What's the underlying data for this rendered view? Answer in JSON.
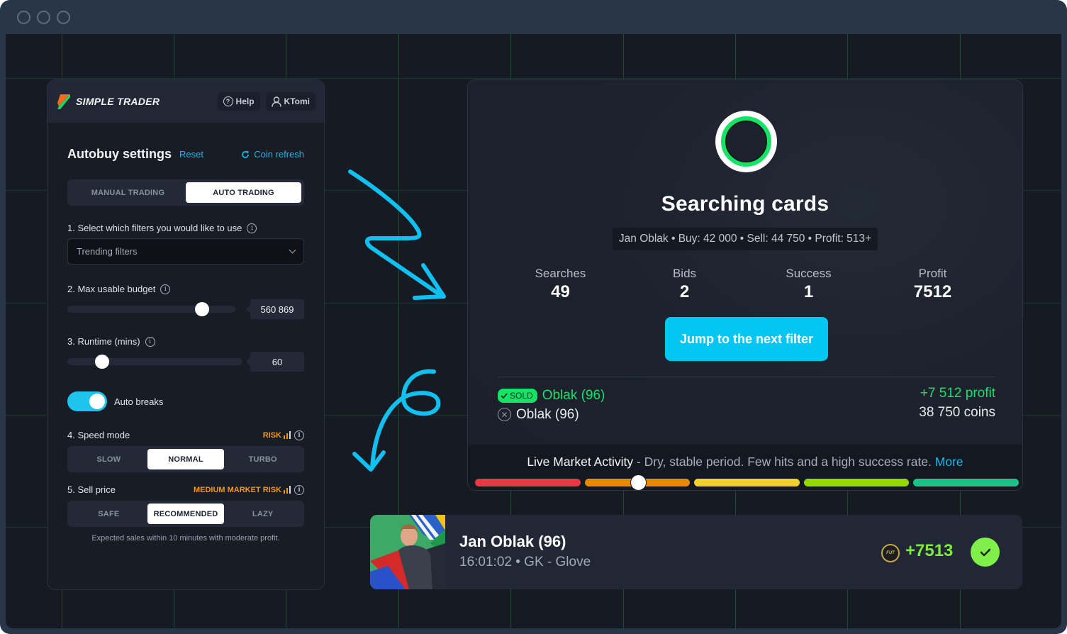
{
  "window": {
    "traffic_lights": [
      "window-dot-1",
      "window-dot-2",
      "window-dot-3"
    ]
  },
  "settings_panel": {
    "brand": "SIMPLE TRADER",
    "header_buttons": {
      "help": {
        "label": "Help",
        "icon": "question-circle-icon"
      },
      "user": {
        "label": "KTomi",
        "icon": "user-icon"
      }
    },
    "title": "Autobuy settings",
    "reset_label": "Reset",
    "coin_refresh_label": "Coin refresh",
    "mode_tabs": [
      {
        "label": "MANUAL TRADING",
        "active": false
      },
      {
        "label": "AUTO TRADING",
        "active": true
      }
    ],
    "filters": {
      "label": "1. Select which filters you would like to use",
      "selected": "Trending filters"
    },
    "budget": {
      "label": "2. Max usable budget",
      "value": "560 869",
      "slider_fraction": 0.8
    },
    "runtime": {
      "label": "3. Runtime (mins)",
      "value": "60",
      "slider_fraction": 0.2
    },
    "auto_breaks": {
      "label": "Auto breaks",
      "enabled": true
    },
    "speed_mode": {
      "label": "4. Speed mode",
      "risk_label": "RISK",
      "risk_level": 2,
      "options": [
        {
          "label": "SLOW",
          "active": false
        },
        {
          "label": "NORMAL",
          "active": true
        },
        {
          "label": "TURBO",
          "active": false
        }
      ]
    },
    "sell_price": {
      "label": "5. Sell price",
      "risk_label": "MEDIUM MARKET RISK",
      "risk_level": 2,
      "options": [
        {
          "label": "SAFE",
          "active": false
        },
        {
          "label": "RECOMMENDED",
          "active": true
        },
        {
          "label": "LAZY",
          "active": false
        }
      ],
      "hint": "Expected sales within 10 minutes with moderate profit."
    }
  },
  "status_panel": {
    "title": "Searching cards",
    "trade_summary": "Jan Oblak • Buy: 42 000 • Sell: 44 750 • Profit: 513+",
    "stats": [
      {
        "label": "Searches",
        "value": "49"
      },
      {
        "label": "Bids",
        "value": "2"
      },
      {
        "label": "Success",
        "value": "1"
      },
      {
        "label": "Profit",
        "value": "7512"
      }
    ],
    "jump_button": "Jump to the next filter",
    "log": {
      "sold_badge": "SOLD",
      "sold_item": "Oblak (96)",
      "failed_item": "Oblak (96)",
      "profit": "+7 512 profit",
      "coins": "38 750 coins"
    },
    "market": {
      "title": "Live Market Activity",
      "description": " - Dry, stable period. Few hits and a high success rate. ",
      "more_link": "More",
      "level_fraction": 0.3,
      "segment_colors": [
        "#e63946",
        "#e88a00",
        "#f0d12a",
        "#93d800",
        "#19c486"
      ]
    }
  },
  "player_card": {
    "name": "Jan Oblak (96)",
    "details": "16:01:02 • GK - Glove",
    "coin_label": "FUT",
    "gain": "+7513",
    "status": "success"
  },
  "colors": {
    "accent": "#03c6f2",
    "success": "#16e266",
    "warning": "#f29a1c"
  }
}
